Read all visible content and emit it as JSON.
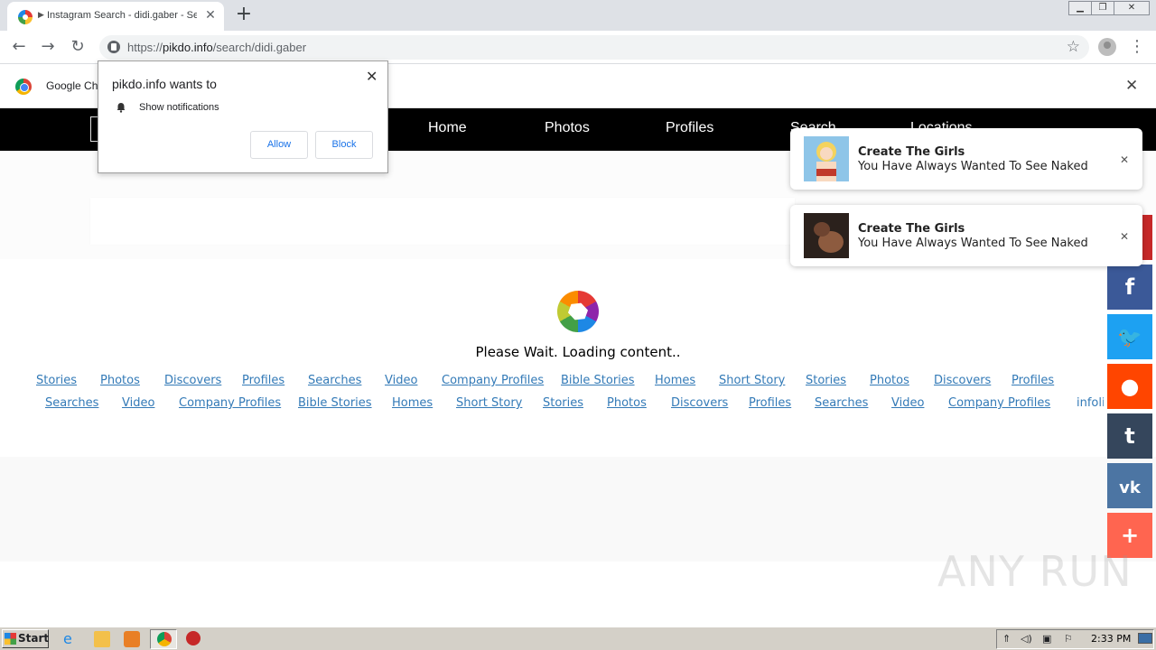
{
  "browser": {
    "tab_title": "Instagram Search - didi.gaber - Se",
    "url_scheme": "https://",
    "url_host": "pikdo.info",
    "url_path": "/search/didi.gaber"
  },
  "infobar": {
    "text": "Google Ch"
  },
  "permission_prompt": {
    "title": "pikdo.info wants to",
    "item": "Show notifications",
    "allow": "Allow",
    "block": "Block"
  },
  "site_nav": {
    "items": [
      "Home",
      "Photos",
      "Profiles",
      "Search",
      "Locations"
    ]
  },
  "main": {
    "loading_text": "Please Wait. Loading content.."
  },
  "links_row1": [
    "Stories",
    "Photos",
    "Discovers",
    "Profiles",
    "Searches",
    "Video",
    "Company Profiles",
    "Bible Stories",
    "Homes",
    "Short Story",
    "Stories",
    "Photos",
    "Discovers",
    "Profiles"
  ],
  "links_row2": [
    "Searches",
    "Video",
    "Company Profiles",
    "Bible Stories",
    "Homes",
    "Short Story",
    "Stories",
    "Photos",
    "Discovers",
    "Profiles",
    "Searches",
    "Video",
    "Company Profiles"
  ],
  "links_row2_tail": "infoli",
  "toasts": [
    {
      "title": "Create The Girls",
      "body": "You Have Always Wanted To See Naked"
    },
    {
      "title": "Create The Girls",
      "body": "You Have Always Wanted To See Naked"
    }
  ],
  "share_buttons": [
    {
      "icon": "facebook-icon",
      "glyph": "f",
      "color": "#3b5998"
    },
    {
      "icon": "twitter-icon",
      "glyph": "🐦",
      "color": "#1da1f2"
    },
    {
      "icon": "reddit-icon",
      "glyph": "●",
      "color": "#ff4500"
    },
    {
      "icon": "tumblr-icon",
      "glyph": "t",
      "color": "#35465c"
    },
    {
      "icon": "vk-icon",
      "glyph": "vk",
      "color": "#4c75a3"
    },
    {
      "icon": "more-icon",
      "glyph": "+",
      "color": "#ff6550"
    }
  ],
  "watermark": "ANY RUN",
  "taskbar": {
    "start": "Start",
    "clock": "2:33 PM"
  }
}
